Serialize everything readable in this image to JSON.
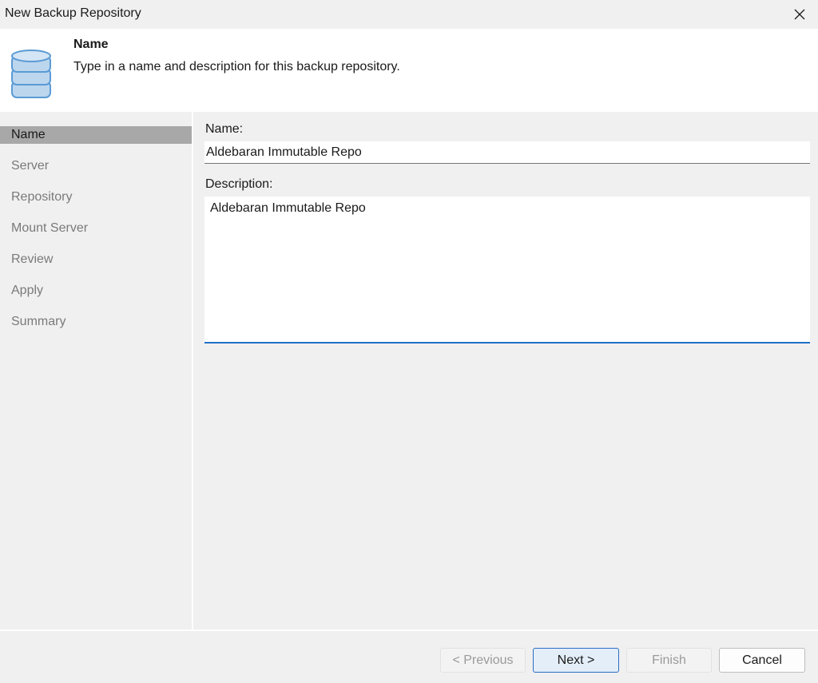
{
  "window": {
    "title": "New Backup Repository"
  },
  "header": {
    "title": "Name",
    "description": "Type in a name and description for this backup repository.",
    "icon": "database-icon"
  },
  "sidebar": {
    "items": [
      {
        "label": "Name",
        "active": true
      },
      {
        "label": "Server",
        "active": false
      },
      {
        "label": "Repository",
        "active": false
      },
      {
        "label": "Mount Server",
        "active": false
      },
      {
        "label": "Review",
        "active": false
      },
      {
        "label": "Apply",
        "active": false
      },
      {
        "label": "Summary",
        "active": false
      }
    ]
  },
  "form": {
    "name_label": "Name:",
    "name_value": "Aldebaran Immutable Repo",
    "description_label": "Description:",
    "description_value": "Aldebaran Immutable Repo"
  },
  "buttons": {
    "previous": "< Previous",
    "next": "Next >",
    "finish": "Finish",
    "cancel": "Cancel"
  },
  "colors": {
    "accent": "#1f6fc6",
    "icon_fill": "#bcd6ee",
    "icon_stroke": "#5b9bd5"
  }
}
